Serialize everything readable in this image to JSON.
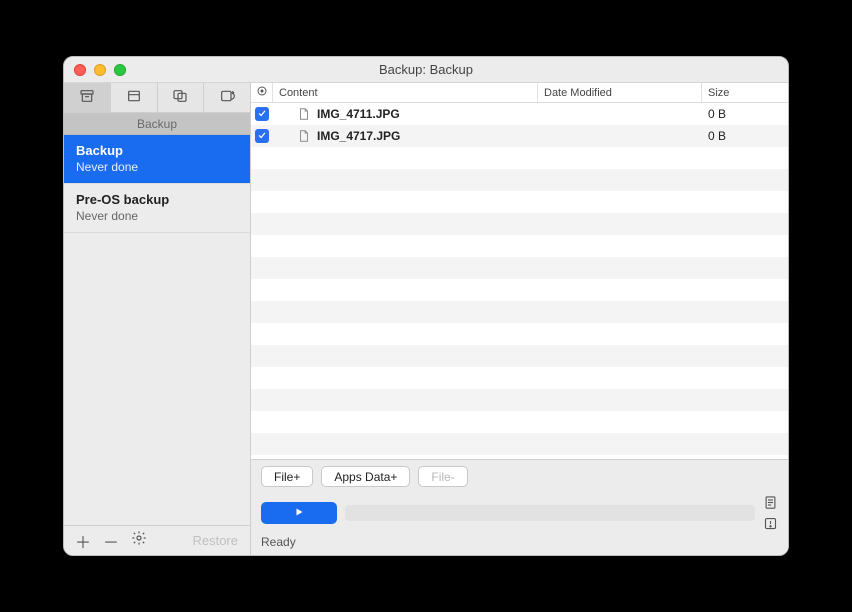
{
  "window": {
    "title": "Backup: Backup"
  },
  "sidebar": {
    "section_label": "Backup",
    "items": [
      {
        "title": "Backup",
        "subtitle": "Never done",
        "selected": true
      },
      {
        "title": "Pre-OS backup",
        "subtitle": "Never done",
        "selected": false
      }
    ],
    "footer": {
      "restore_label": "Restore"
    }
  },
  "table": {
    "columns": {
      "content_label": "Content",
      "date_label": "Date Modified",
      "size_label": "Size"
    },
    "rows": [
      {
        "checked": true,
        "name": "IMG_4711.JPG",
        "date": "",
        "size": "0 B"
      },
      {
        "checked": true,
        "name": "IMG_4717.JPG",
        "date": "",
        "size": "0 B"
      }
    ],
    "blank_row_count": 16
  },
  "toolbar": {
    "add_file_label": "File+",
    "apps_data_label": "Apps Data+",
    "remove_file_label": "File-"
  },
  "status": {
    "text": "Ready"
  }
}
